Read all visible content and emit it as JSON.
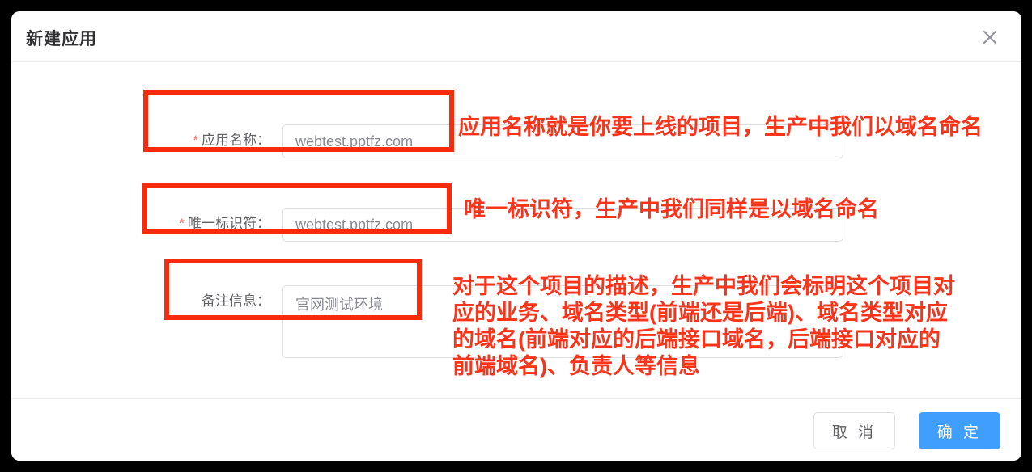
{
  "dialog": {
    "title": "新建应用",
    "close_icon": "close-icon"
  },
  "form": {
    "rows": [
      {
        "required": "*",
        "label": "应用名称：",
        "value": "webtest.pptfz.com",
        "type": "input"
      },
      {
        "required": "*",
        "label": "唯一标识符：",
        "value": "webtest.pptfz.com",
        "type": "input"
      },
      {
        "required": "",
        "label": "备注信息：",
        "value": "官网测试环境",
        "type": "textarea"
      }
    ]
  },
  "annotations": {
    "note_1": "应用名称就是你要上线的项目，生产中我们以域名命名",
    "note_2": "唯一标识符，生产中我们同样是以域名命名",
    "note_3": "对于这个项目的描述，生产中我们会标明这个项目对\n应的业务、域名类型(前端还是后端)、域名类型对应\n的域名(前端对应的后端接口域名，后端接口对应的\n前端域名)、负责人等信息"
  },
  "footer": {
    "cancel_label": "取 消",
    "confirm_label": "确 定"
  },
  "colors": {
    "accent_blue": "#409eff",
    "annotation_red": "#f9341a",
    "required_red": "#f56c6c",
    "page_background": "#000000",
    "dialog_background": "#ffffff"
  }
}
